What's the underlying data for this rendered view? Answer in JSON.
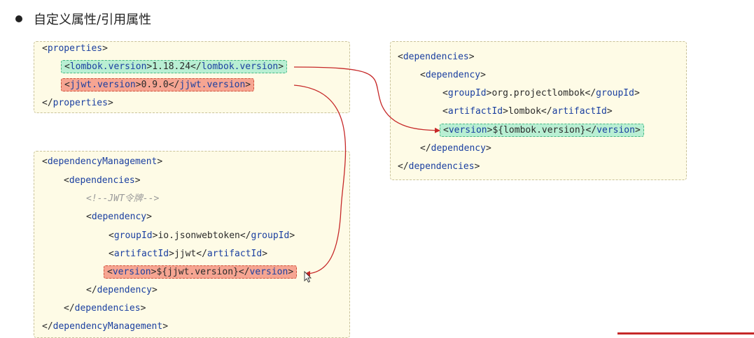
{
  "heading": {
    "text": "自定义属性/引用属性"
  },
  "properties_box": {
    "open": "properties",
    "items": [
      {
        "tag": "lombok.version",
        "value": "1.18.24",
        "color": "#b9efd3"
      },
      {
        "tag": "jjwt.version",
        "value": "0.9.0",
        "color": "#f6a592"
      }
    ],
    "close": "properties"
  },
  "right_box": {
    "dependencies_tag": "dependencies",
    "dependency_tag": "dependency",
    "groupId_tag": "groupId",
    "groupId_value": "org.projectlombok",
    "artifactId_tag": "artifactId",
    "artifactId_value": "lombok",
    "version_tag": "version",
    "version_value": "${lombok.version}"
  },
  "left_box": {
    "management_tag": "dependencyManagement",
    "dependencies_tag": "dependencies",
    "comment": "<!--JWT令牌-->",
    "dependency_tag": "dependency",
    "groupId_tag": "groupId",
    "groupId_value": "io.jsonwebtoken",
    "artifactId_tag": "artifactId",
    "artifactId_value": "jjwt",
    "version_tag": "version",
    "version_value": "${jjwt.version}"
  },
  "colors": {
    "tag": "#1a3fa0",
    "green_highlight": "#b9efd3",
    "red_highlight": "#f6a592",
    "arrow": "#c62828",
    "box_bg": "#fefbe6"
  }
}
